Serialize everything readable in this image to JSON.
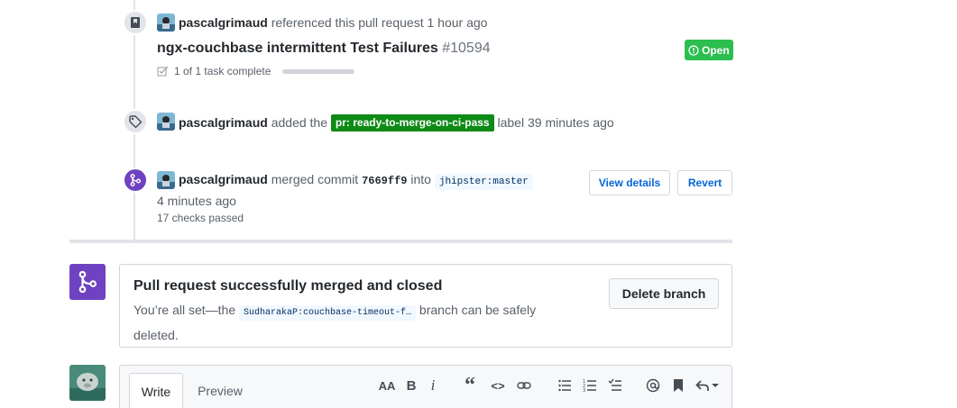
{
  "events": [
    {
      "author": "pascalgrimaud",
      "action": "referenced this pull request",
      "time": "1 hour ago",
      "icon": "bookmark-icon",
      "pr": {
        "title": "ngx-couchbase intermittent Test Failures",
        "number": "#10594",
        "status": "Open",
        "tasks": "1 of 1 task complete",
        "task_progress": 1.0
      }
    },
    {
      "author": "pascalgrimaud",
      "action_before": "added the",
      "label": "pr: ready-to-merge-on-ci-pass",
      "action_after": "label",
      "time": "39 minutes ago",
      "icon": "tag-icon"
    },
    {
      "author": "pascalgrimaud",
      "action": "merged commit",
      "sha": "7669ff9",
      "into": "into",
      "branch": "jhipster:master",
      "time": "4 minutes ago",
      "checks": "17 checks passed",
      "icon": "git-merge-icon",
      "view_details_label": "View details",
      "revert_label": "Revert"
    }
  ],
  "merge_status": {
    "title": "Pull request successfully merged and closed",
    "desc_before": "You’re all set—the",
    "branch": "SudharakaP:couchbase-timeout-f…",
    "desc_after": "branch can be safely deleted.",
    "delete_label": "Delete branch"
  },
  "comment": {
    "tab_write": "Write",
    "tab_preview": "Preview",
    "toolbar": {
      "heading": "AA",
      "bold": "B",
      "italic": "i",
      "quote": "“",
      "code": "<>"
    }
  },
  "colors": {
    "open_green": "#2cbe4e",
    "label_green": "#0e8a16",
    "merged_purple": "#6f42c1",
    "link_blue": "#0366d6"
  }
}
